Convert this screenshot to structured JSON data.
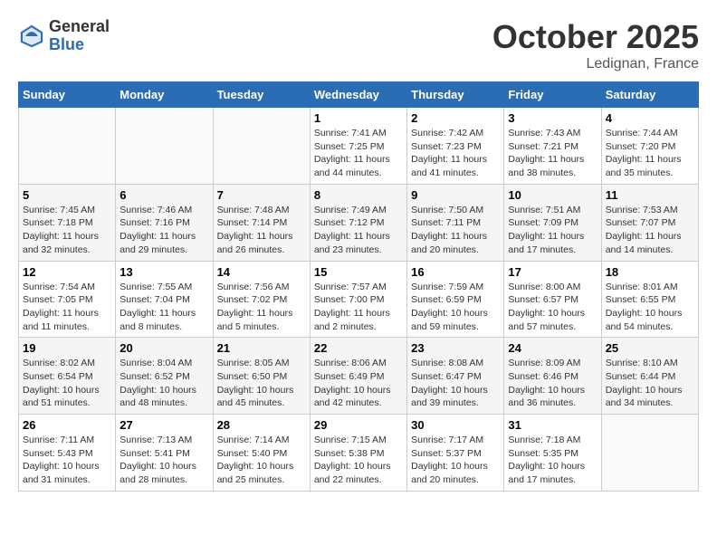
{
  "logo": {
    "general": "General",
    "blue": "Blue"
  },
  "header": {
    "month": "October 2025",
    "location": "Ledignan, France"
  },
  "days_of_week": [
    "Sunday",
    "Monday",
    "Tuesday",
    "Wednesday",
    "Thursday",
    "Friday",
    "Saturday"
  ],
  "weeks": [
    [
      {
        "num": "",
        "detail": ""
      },
      {
        "num": "",
        "detail": ""
      },
      {
        "num": "",
        "detail": ""
      },
      {
        "num": "1",
        "detail": "Sunrise: 7:41 AM\nSunset: 7:25 PM\nDaylight: 11 hours and 44 minutes."
      },
      {
        "num": "2",
        "detail": "Sunrise: 7:42 AM\nSunset: 7:23 PM\nDaylight: 11 hours and 41 minutes."
      },
      {
        "num": "3",
        "detail": "Sunrise: 7:43 AM\nSunset: 7:21 PM\nDaylight: 11 hours and 38 minutes."
      },
      {
        "num": "4",
        "detail": "Sunrise: 7:44 AM\nSunset: 7:20 PM\nDaylight: 11 hours and 35 minutes."
      }
    ],
    [
      {
        "num": "5",
        "detail": "Sunrise: 7:45 AM\nSunset: 7:18 PM\nDaylight: 11 hours and 32 minutes."
      },
      {
        "num": "6",
        "detail": "Sunrise: 7:46 AM\nSunset: 7:16 PM\nDaylight: 11 hours and 29 minutes."
      },
      {
        "num": "7",
        "detail": "Sunrise: 7:48 AM\nSunset: 7:14 PM\nDaylight: 11 hours and 26 minutes."
      },
      {
        "num": "8",
        "detail": "Sunrise: 7:49 AM\nSunset: 7:12 PM\nDaylight: 11 hours and 23 minutes."
      },
      {
        "num": "9",
        "detail": "Sunrise: 7:50 AM\nSunset: 7:11 PM\nDaylight: 11 hours and 20 minutes."
      },
      {
        "num": "10",
        "detail": "Sunrise: 7:51 AM\nSunset: 7:09 PM\nDaylight: 11 hours and 17 minutes."
      },
      {
        "num": "11",
        "detail": "Sunrise: 7:53 AM\nSunset: 7:07 PM\nDaylight: 11 hours and 14 minutes."
      }
    ],
    [
      {
        "num": "12",
        "detail": "Sunrise: 7:54 AM\nSunset: 7:05 PM\nDaylight: 11 hours and 11 minutes."
      },
      {
        "num": "13",
        "detail": "Sunrise: 7:55 AM\nSunset: 7:04 PM\nDaylight: 11 hours and 8 minutes."
      },
      {
        "num": "14",
        "detail": "Sunrise: 7:56 AM\nSunset: 7:02 PM\nDaylight: 11 hours and 5 minutes."
      },
      {
        "num": "15",
        "detail": "Sunrise: 7:57 AM\nSunset: 7:00 PM\nDaylight: 11 hours and 2 minutes."
      },
      {
        "num": "16",
        "detail": "Sunrise: 7:59 AM\nSunset: 6:59 PM\nDaylight: 10 hours and 59 minutes."
      },
      {
        "num": "17",
        "detail": "Sunrise: 8:00 AM\nSunset: 6:57 PM\nDaylight: 10 hours and 57 minutes."
      },
      {
        "num": "18",
        "detail": "Sunrise: 8:01 AM\nSunset: 6:55 PM\nDaylight: 10 hours and 54 minutes."
      }
    ],
    [
      {
        "num": "19",
        "detail": "Sunrise: 8:02 AM\nSunset: 6:54 PM\nDaylight: 10 hours and 51 minutes."
      },
      {
        "num": "20",
        "detail": "Sunrise: 8:04 AM\nSunset: 6:52 PM\nDaylight: 10 hours and 48 minutes."
      },
      {
        "num": "21",
        "detail": "Sunrise: 8:05 AM\nSunset: 6:50 PM\nDaylight: 10 hours and 45 minutes."
      },
      {
        "num": "22",
        "detail": "Sunrise: 8:06 AM\nSunset: 6:49 PM\nDaylight: 10 hours and 42 minutes."
      },
      {
        "num": "23",
        "detail": "Sunrise: 8:08 AM\nSunset: 6:47 PM\nDaylight: 10 hours and 39 minutes."
      },
      {
        "num": "24",
        "detail": "Sunrise: 8:09 AM\nSunset: 6:46 PM\nDaylight: 10 hours and 36 minutes."
      },
      {
        "num": "25",
        "detail": "Sunrise: 8:10 AM\nSunset: 6:44 PM\nDaylight: 10 hours and 34 minutes."
      }
    ],
    [
      {
        "num": "26",
        "detail": "Sunrise: 7:11 AM\nSunset: 5:43 PM\nDaylight: 10 hours and 31 minutes."
      },
      {
        "num": "27",
        "detail": "Sunrise: 7:13 AM\nSunset: 5:41 PM\nDaylight: 10 hours and 28 minutes."
      },
      {
        "num": "28",
        "detail": "Sunrise: 7:14 AM\nSunset: 5:40 PM\nDaylight: 10 hours and 25 minutes."
      },
      {
        "num": "29",
        "detail": "Sunrise: 7:15 AM\nSunset: 5:38 PM\nDaylight: 10 hours and 22 minutes."
      },
      {
        "num": "30",
        "detail": "Sunrise: 7:17 AM\nSunset: 5:37 PM\nDaylight: 10 hours and 20 minutes."
      },
      {
        "num": "31",
        "detail": "Sunrise: 7:18 AM\nSunset: 5:35 PM\nDaylight: 10 hours and 17 minutes."
      },
      {
        "num": "",
        "detail": ""
      }
    ]
  ]
}
